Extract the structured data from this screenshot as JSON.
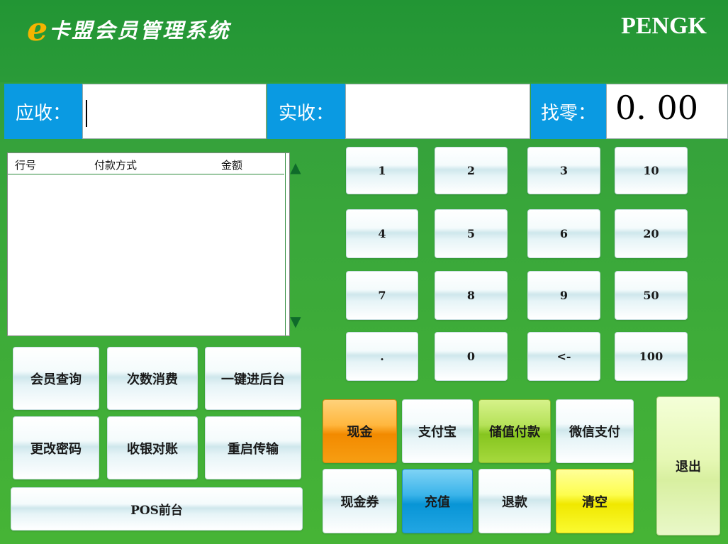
{
  "header": {
    "logo_letter": "e",
    "app_title": "卡盟会员管理系统",
    "brand": "PENGK"
  },
  "amounts": {
    "receivable_label": "应收：",
    "receivable_value": "",
    "received_label": "实收：",
    "received_value": "",
    "change_label": "找零：",
    "change_value": "0. 00"
  },
  "payment_grid": {
    "columns": [
      "行号",
      "付款方式",
      "金额"
    ],
    "rows": []
  },
  "keypad": {
    "keys": [
      "1",
      "2",
      "3",
      "10",
      "4",
      "5",
      "6",
      "20",
      "7",
      "8",
      "9",
      "50",
      ".",
      "0",
      "<-",
      "100"
    ]
  },
  "actions": {
    "member_query": "会员查询",
    "count_consume": "次数消费",
    "backend": "一键进后台",
    "change_password": "更改密码",
    "reconcile": "收银对账",
    "restart_transfer": "重启传输",
    "pos_front": "POS前台"
  },
  "payments": {
    "cash": "现金",
    "alipay": "支付宝",
    "stored_value": "储值付款",
    "wechat": "微信支付",
    "voucher": "现金券",
    "recharge": "充值",
    "refund": "退款",
    "clear": "清空",
    "exit": "退出"
  },
  "colors": {
    "background_green": "#3aa83a",
    "label_blue": "#0a9ae2",
    "logo_orange": "#f4b400"
  }
}
